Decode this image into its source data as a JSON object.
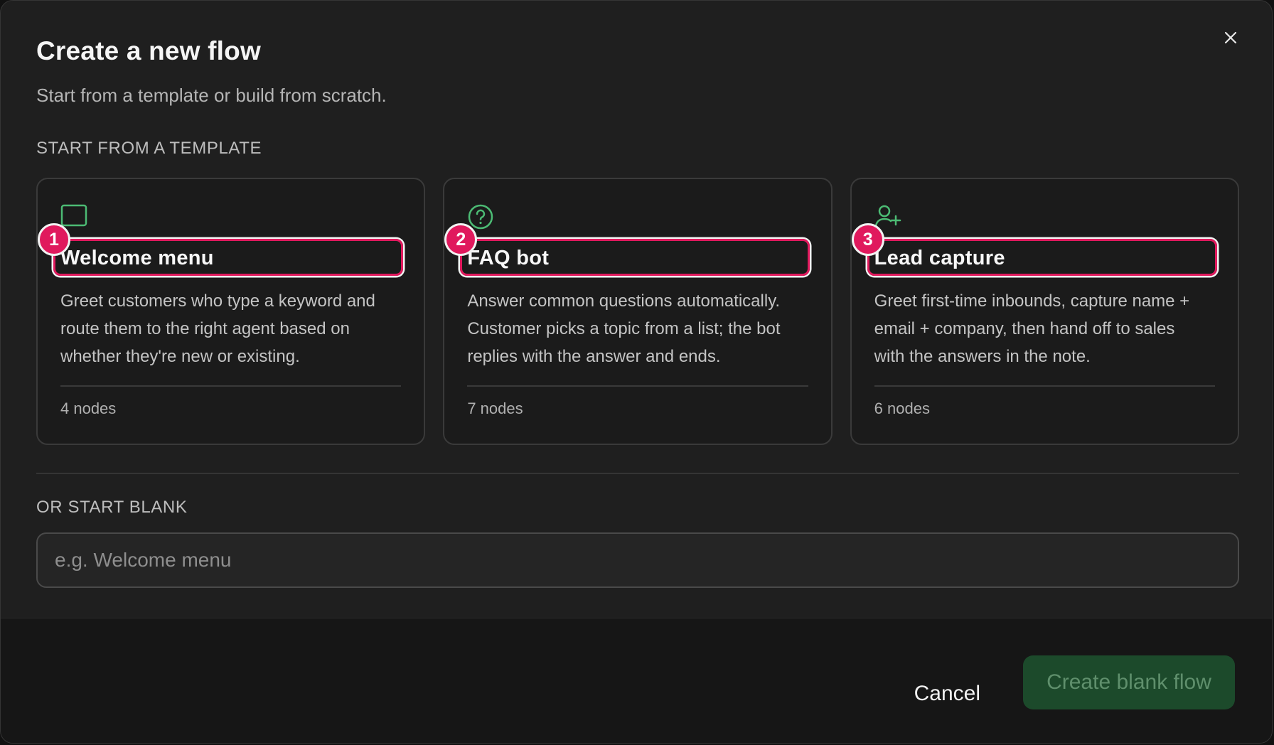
{
  "dialog": {
    "title": "Create a new flow",
    "subtitle": "Start from a template or build from scratch.",
    "close_label": "×"
  },
  "templates_section": {
    "label": "START FROM A TEMPLATE",
    "cards": [
      {
        "badge": "1",
        "icon": "chat-bubble-icon",
        "title": "Welcome menu",
        "description": "Greet customers who type a keyword and route them to the right agent based on whether they're new or existing.",
        "node_count": "4 nodes"
      },
      {
        "badge": "2",
        "icon": "question-circle-icon",
        "title": "FAQ bot",
        "description": "Answer common questions automatically. Customer picks a topic from a list; the bot replies with the answer and ends.",
        "node_count": "7 nodes"
      },
      {
        "badge": "3",
        "icon": "user-plus-icon",
        "title": "Lead capture",
        "description": "Greet first-time inbounds, capture name + email + company, then hand off to sales with the answers in the note.",
        "node_count": "6 nodes"
      }
    ]
  },
  "blank_section": {
    "label": "OR START BLANK",
    "input_placeholder": "e.g. Welcome menu",
    "input_value": ""
  },
  "footer": {
    "cancel_label": "Cancel",
    "create_label": "Create blank flow"
  },
  "colors": {
    "icon_green": "#4cbb74",
    "highlight": "#e0195d",
    "primary_disabled_bg": "#1c4a2b",
    "primary_disabled_text": "#5f8f6c"
  }
}
